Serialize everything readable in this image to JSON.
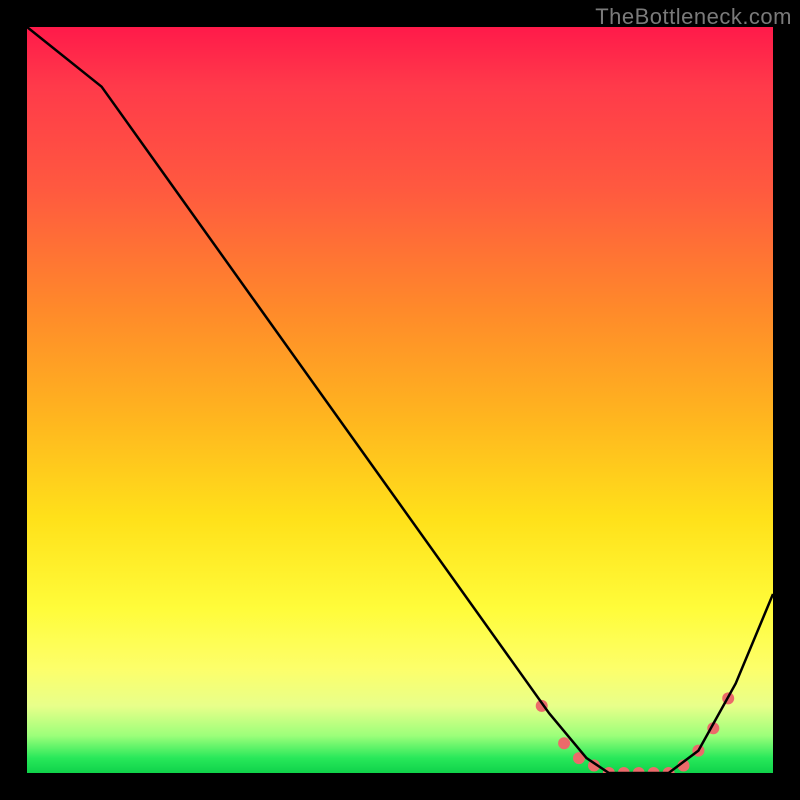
{
  "watermark": "TheBottleneck.com",
  "chart_data": {
    "type": "line",
    "title": "",
    "xlabel": "",
    "ylabel": "",
    "xlim": [
      0,
      100
    ],
    "ylim": [
      0,
      100
    ],
    "background_gradient": {
      "direction": "vertical",
      "stops": [
        {
          "pos": 0.0,
          "color": "#ff1a4a"
        },
        {
          "pos": 0.08,
          "color": "#ff3a4a"
        },
        {
          "pos": 0.22,
          "color": "#ff5a3f"
        },
        {
          "pos": 0.38,
          "color": "#ff8a2a"
        },
        {
          "pos": 0.52,
          "color": "#ffb41f"
        },
        {
          "pos": 0.66,
          "color": "#ffe11a"
        },
        {
          "pos": 0.78,
          "color": "#fffc3a"
        },
        {
          "pos": 0.86,
          "color": "#fdff6a"
        },
        {
          "pos": 0.91,
          "color": "#e8ff8a"
        },
        {
          "pos": 0.95,
          "color": "#9cff7a"
        },
        {
          "pos": 0.98,
          "color": "#28e85a"
        },
        {
          "pos": 1.0,
          "color": "#0fd24a"
        }
      ]
    },
    "series": [
      {
        "name": "bottleneck-curve",
        "color": "#000000",
        "x": [
          0,
          10,
          20,
          30,
          40,
          50,
          60,
          70,
          75,
          78,
          82,
          86,
          90,
          95,
          100
        ],
        "y": [
          100,
          92,
          78,
          64,
          50,
          36,
          22,
          8,
          2,
          0,
          0,
          0,
          3,
          12,
          24
        ]
      }
    ],
    "markers": {
      "name": "highlight-band",
      "color": "#ec6a6a",
      "series_index": 0,
      "x": [
        69,
        72,
        74,
        76,
        78,
        80,
        82,
        84,
        86,
        88,
        90,
        92,
        94
      ],
      "y": [
        9,
        4,
        2,
        1,
        0,
        0,
        0,
        0,
        0,
        1,
        3,
        6,
        10
      ]
    }
  }
}
